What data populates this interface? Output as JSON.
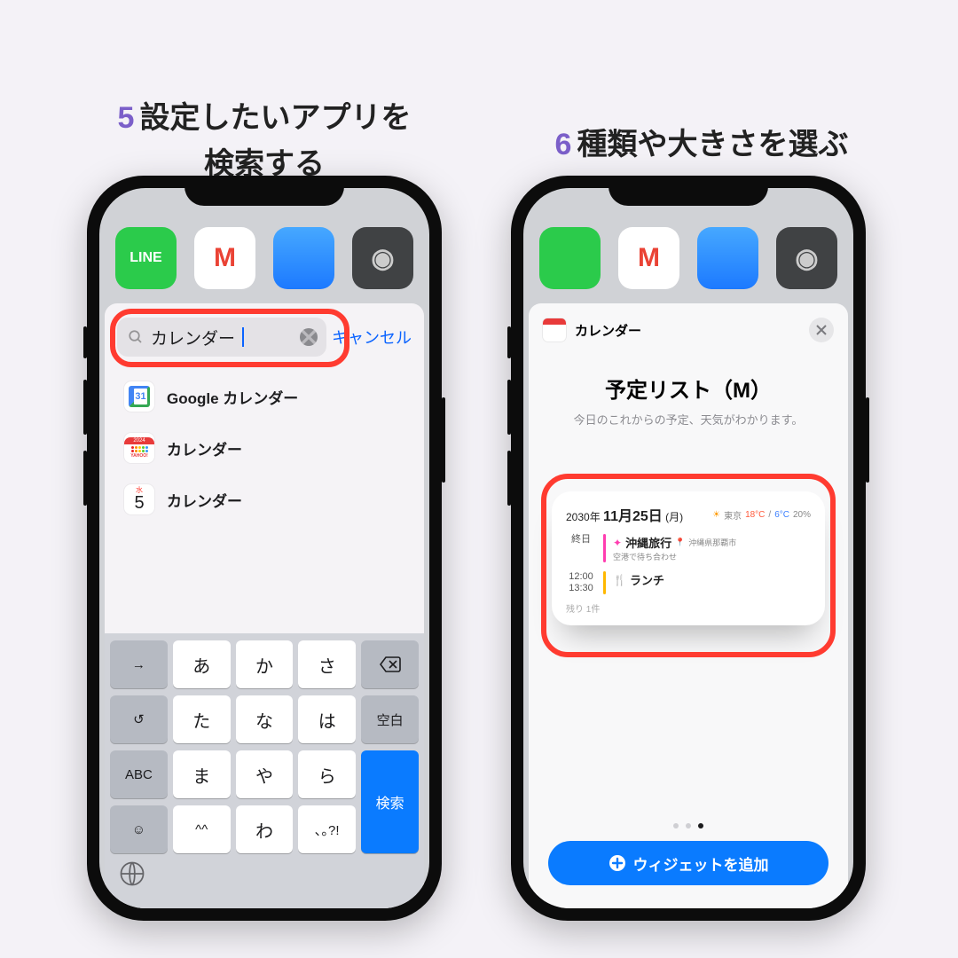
{
  "steps": {
    "s5_num": "5",
    "s5_text": "設定したいアプリを\n検索する",
    "s6_num": "6",
    "s6_text": "種類や大きさを選ぶ"
  },
  "left": {
    "apps": {
      "line": "LINE",
      "gmail": "M",
      "safari": "",
      "camera": "◉"
    },
    "search_value": "カレンダー",
    "cancel": "キャンセル",
    "results": [
      {
        "icon": "google-calendar",
        "label": "Google カレンダー"
      },
      {
        "icon": "yahoo-calendar",
        "label": "カレンダー",
        "year": "2024",
        "brand": "YAHOO!"
      },
      {
        "icon": "ios-calendar",
        "label": "カレンダー",
        "weekday": "水",
        "day": "5"
      }
    ],
    "keyboard": {
      "r1": [
        "→",
        "あ",
        "か",
        "さ",
        "⌫"
      ],
      "r2": [
        "↺",
        "た",
        "な",
        "は",
        "空白"
      ],
      "r3": [
        "ABC",
        "ま",
        "や",
        "ら",
        "検索"
      ],
      "r4": [
        "☺",
        "^^",
        "わ",
        "､｡?!",
        ""
      ]
    }
  },
  "right": {
    "header_title": "カレンダー",
    "widget_title": "予定リスト（M）",
    "widget_sub": "今日のこれからの予定、天気がわかります。",
    "preview": {
      "date_year": "2030年",
      "date_md": "11月25日",
      "date_wd": "(月)",
      "wx_city": "東京",
      "wx_hi": "18°C",
      "wx_lo": "6°C",
      "wx_pop": "20%",
      "ev1_time": "終日",
      "ev1_title": "沖縄旅行",
      "ev1_loc": "沖縄県那覇市",
      "ev1_sub": "空港で待ち合わせ",
      "ev2_t1": "12:00",
      "ev2_t2": "13:30",
      "ev2_title": "ランチ",
      "remaining": "残り 1件"
    },
    "add_button": "ウィジェットを追加"
  }
}
